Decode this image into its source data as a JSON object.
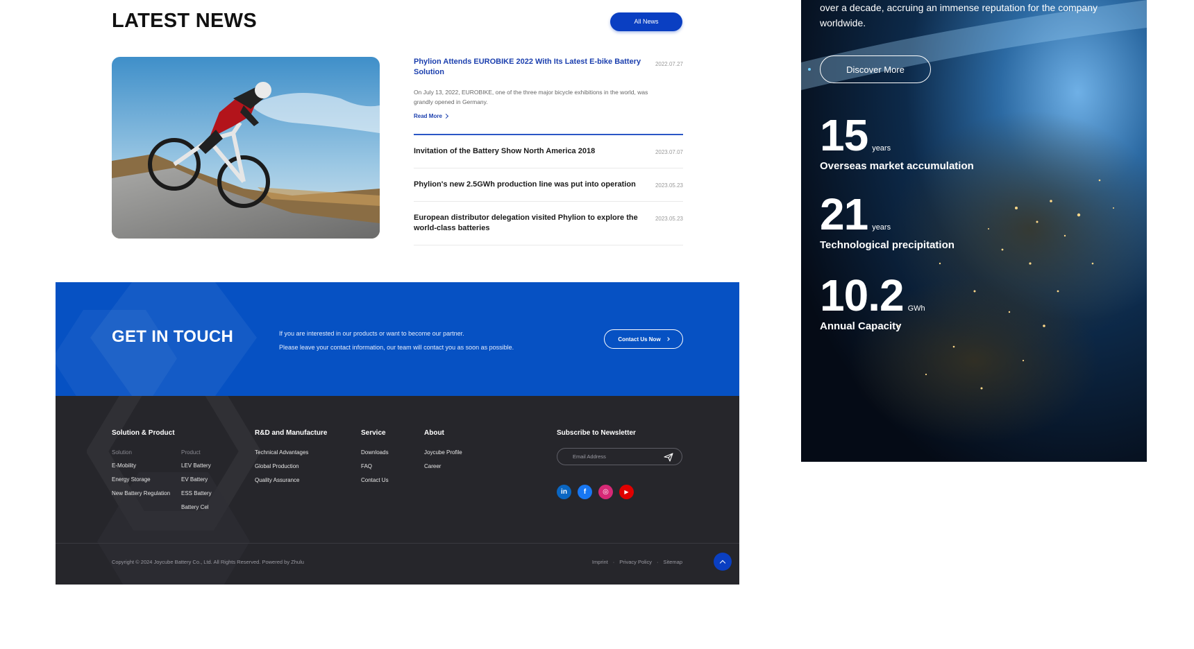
{
  "news": {
    "title": "LATEST NEWS",
    "all_news_label": "All News",
    "featured": {
      "title": "Phylion Attends EUROBIKE 2022 With Its Latest E-bike Battery Solution",
      "date": "2022.07.27",
      "description": "On July 13, 2022, EUROBIKE, one of the three major bicycle exhibitions in the world, was grandly opened in Germany.",
      "read_more": "Read More"
    },
    "items": [
      {
        "title": "Invitation of the Battery Show North America 2018",
        "date": "2023.07.07"
      },
      {
        "title": "Phylion's new 2.5GWh production line was put into operation",
        "date": "2023.05.23"
      },
      {
        "title": "European distributor delegation visited Phylion to explore the world-class batteries",
        "date": "2023.05.23"
      }
    ]
  },
  "contact": {
    "title": "GET IN TOUCH",
    "line1": "If you are interested in our products or want to become our partner.",
    "line2": "Please leave your contact information, our team will contact you as soon as possible.",
    "button": "Contact Us Now"
  },
  "footer": {
    "solution_product": {
      "title": "Solution & Product",
      "solution_label": "Solution",
      "product_label": "Product",
      "solutions": [
        "E-Mobility",
        "Energy Storage",
        "New Battery Regulation"
      ],
      "products": [
        "LEV Battery",
        "EV Battery",
        "ESS Battery",
        "Battery Cel"
      ]
    },
    "rd": {
      "title": "R&D and Manufacture",
      "links": [
        "Technical Advantages",
        "Global Production",
        "Quality Assurance"
      ]
    },
    "service": {
      "title": "Service",
      "links": [
        "Downloads",
        "FAQ",
        "Contact Us"
      ]
    },
    "about": {
      "title": "About",
      "links": [
        "Joycube Profile",
        "Career"
      ]
    },
    "newsletter": {
      "title": "Subscribe to Newsletter",
      "placeholder": "Email Address"
    },
    "social": [
      {
        "icon": "linkedin-icon",
        "glyph": "in",
        "color": "#0a66c2"
      },
      {
        "icon": "facebook-icon",
        "glyph": "f",
        "color": "#1877f2"
      },
      {
        "icon": "instagram-icon",
        "glyph": "◎",
        "color": "#d62976"
      },
      {
        "icon": "youtube-icon",
        "glyph": "▶",
        "color": "#e00000"
      }
    ],
    "copyright": "Copyright © 2024 Joycube Battery Co., Ltd. All Rights Reserved. Powered by Zhulu",
    "legal": [
      "Imprint",
      "Privacy Policy",
      "Sitemap"
    ],
    "legal_separator": "·"
  },
  "panel": {
    "intro": "over a decade, accruing an immense reputation for the company worldwide.",
    "discover": "Discover More",
    "stats": [
      {
        "num": "15",
        "unit": "years",
        "label": "Overseas market accumulation"
      },
      {
        "num": "21",
        "unit": "years",
        "label": "Technological precipitation"
      },
      {
        "num": "10.2",
        "unit": "GWh",
        "label": "Annual Capacity"
      }
    ]
  },
  "colors": {
    "accent": "#0a3fc2",
    "contact_band": "#0651c3",
    "footer": "#26262b"
  }
}
